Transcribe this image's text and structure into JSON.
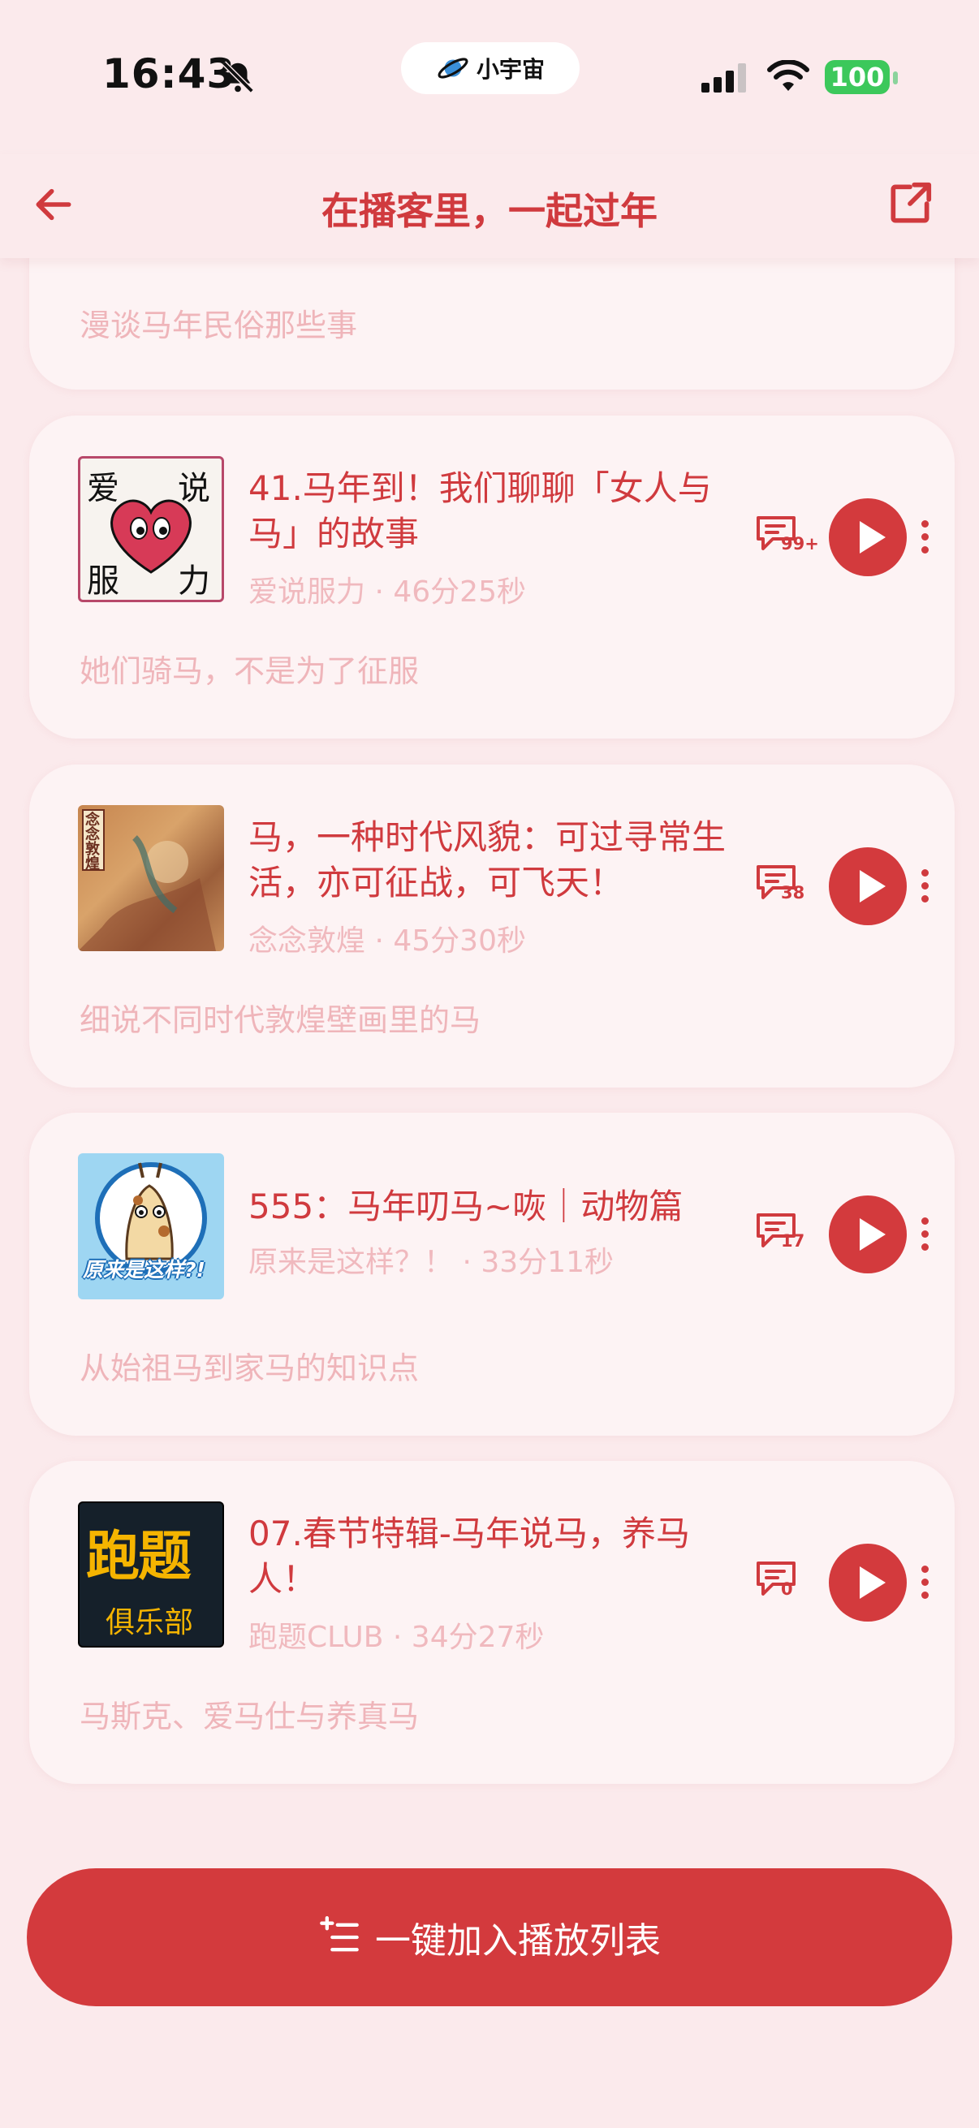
{
  "status_bar": {
    "time": "16:43",
    "island_label": "小宇宙",
    "battery": "100"
  },
  "header": {
    "title": "在播客里，一起过年"
  },
  "partial_card": {
    "description": "漫谈马年民俗那些事"
  },
  "episodes": [
    {
      "title": "41.马年到！我们聊聊「女人与马」的故事",
      "podcast": "爱说服力",
      "duration": "46分25秒",
      "comments": "99+",
      "description": "她们骑马，不是为了征服",
      "cover_text": [
        "爱",
        "说",
        "服",
        "力"
      ]
    },
    {
      "title": "马，一种时代风貌：可过寻常生活，亦可征战，可飞天！",
      "podcast": "念念敦煌",
      "duration": "45分30秒",
      "comments": "38",
      "description": "细说不同时代敦煌壁画里的马",
      "cover_text": [
        "念念敦煌"
      ]
    },
    {
      "title": "555：马年叨马~咴｜动物篇",
      "podcast": "原来是这样？！",
      "duration": "33分11秒",
      "comments": "17",
      "description": "从始祖马到家马的知识点",
      "cover_text": [
        "原来是这样?!"
      ]
    },
    {
      "title": "07.春节特辑-马年说马，养马人！",
      "podcast": "跑题CLUB",
      "duration": "34分27秒",
      "comments": "0",
      "description": "马斯克、爱马仕与养真马",
      "cover_text": [
        "跑题",
        "俱乐部"
      ]
    }
  ],
  "separator": " · ",
  "footer": {
    "add_all_label": "一键加入播放列表"
  },
  "colors": {
    "accent": "#D33A3D",
    "background": "#FBEAEC",
    "card": "#FDF3F4",
    "muted_text": "#F0B9BE"
  }
}
